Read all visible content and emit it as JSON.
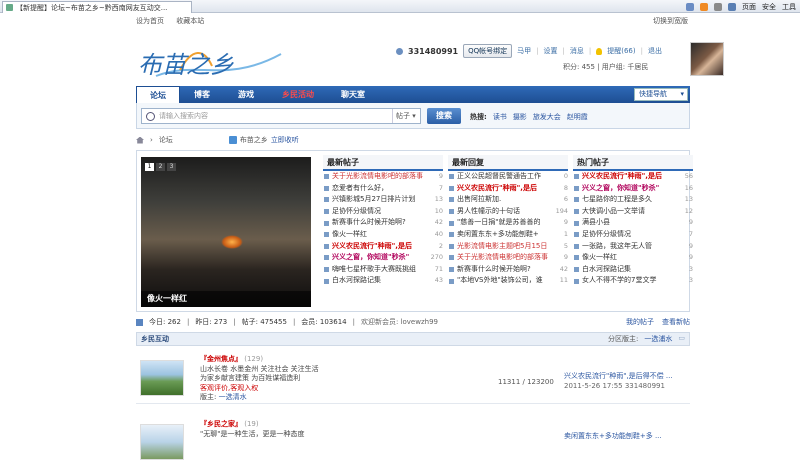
{
  "browser": {
    "tab_title": "【新提醒】论坛~布苗之乡~黔西南网友互动交...",
    "tools": [
      "页面",
      "安全",
      "工具"
    ]
  },
  "toplinks": {
    "set_home": "设为首页",
    "bookmark": "收藏本站",
    "switch_width": "切换到宽版"
  },
  "logo": {
    "text": "布苗之乡"
  },
  "user": {
    "id": "331480991",
    "qq_bind": "QQ帐号绑定",
    "links": [
      "马甲",
      "设置",
      "消息"
    ],
    "reminder": "提醒(66)",
    "logout": "退出",
    "score": "积分: 455",
    "group": "用户组: 千居民"
  },
  "nav": {
    "items": [
      "论坛",
      "博客",
      "游戏",
      "乡民活动",
      "聊天室"
    ],
    "quick": "快捷导航"
  },
  "search": {
    "placeholder": "请输入搜索内容",
    "scope": "帖子",
    "button": "搜索",
    "hot_label": "热搜:",
    "hot_words": [
      "读书",
      "摄影",
      "旅发大会",
      "赵明霞"
    ]
  },
  "breadcrumb": {
    "current": "论坛",
    "site": "布苗之乡",
    "fav": "立即收听"
  },
  "slideshow": {
    "pages": [
      "1",
      "2",
      "3"
    ],
    "caption": "像火一样红"
  },
  "columns": [
    {
      "title": "最新帖子",
      "items": [
        {
          "t": "关于光影流情电影吧的部落事",
          "n": "9",
          "s": "hl3"
        },
        {
          "t": "恋爱者有什么好，",
          "n": "7",
          "s": ""
        },
        {
          "t": "兴镇影城5月27日排片计划",
          "n": "13",
          "s": ""
        },
        {
          "t": "足协怀分级情况",
          "n": "10",
          "s": ""
        },
        {
          "t": "新赛事什么时候开始啊?",
          "n": "42",
          "s": ""
        },
        {
          "t": "像火一样红",
          "n": "40",
          "s": ""
        },
        {
          "t": "兴义农民流行\"种雨\",是后",
          "n": "2",
          "s": "hl"
        },
        {
          "t": "兴义之窗，你知道\"秒杀\"",
          "n": "270",
          "s": "hl2"
        },
        {
          "t": "嗨唯七星杯歌手大赛既挑组",
          "n": "71",
          "s": ""
        },
        {
          "t": "白水河探路记集",
          "n": "43",
          "s": ""
        }
      ]
    },
    {
      "title": "最新回复",
      "items": [
        {
          "t": "正义公民超督民警通告工作",
          "n": "0",
          "s": ""
        },
        {
          "t": "兴义农民流行\"种雨\",是后",
          "n": "8",
          "s": "hl"
        },
        {
          "t": "出售阿拉斯加.",
          "n": "6",
          "s": ""
        },
        {
          "t": "男人性幢示的十句话",
          "n": "194",
          "s": ""
        },
        {
          "t": "\"慈善一日捐\"就是苏善善的",
          "n": "9",
          "s": ""
        },
        {
          "t": "卖闲置东东+多功能刨鞋+",
          "n": "1",
          "s": ""
        },
        {
          "t": "光影流情电影主题吧5月15日",
          "n": "5",
          "s": "hl3"
        },
        {
          "t": "关于光影流情电影吧的部落事",
          "n": "9",
          "s": "hl3"
        },
        {
          "t": "新赛事什么时候开始啊?",
          "n": "42",
          "s": ""
        },
        {
          "t": "\"本地VS外地\"装饰公司，谁",
          "n": "11",
          "s": ""
        }
      ]
    },
    {
      "title": "热门帖子",
      "items": [
        {
          "t": "兴义农民流行\"种雨\",是后",
          "n": "56",
          "s": "hl"
        },
        {
          "t": "兴义之窗，你知道\"秒杀\"",
          "n": "16",
          "s": "hl2"
        },
        {
          "t": "七星路你的工程是多久",
          "n": "13",
          "s": ""
        },
        {
          "t": "大侠调小品一文举请",
          "n": "12",
          "s": ""
        },
        {
          "t": "满县小县",
          "n": "9",
          "s": ""
        },
        {
          "t": "足协怀分级情况",
          "n": "7",
          "s": ""
        },
        {
          "t": "一张路，我这年无人管",
          "n": "9",
          "s": ""
        },
        {
          "t": "像火一样红",
          "n": "9",
          "s": ""
        },
        {
          "t": "白水河探路记集",
          "n": "3",
          "s": ""
        },
        {
          "t": "女人不得不学的7堂文学",
          "n": "3",
          "s": ""
        }
      ]
    }
  ],
  "stats": {
    "today": "今日: 262",
    "yesterday": "昨日: 273",
    "posts": "帖子: 475455",
    "members": "会员: 103614",
    "welcome": "欢迎新会员: lovewzh99",
    "my_posts": "我的帖子",
    "view_new": "查看新帖"
  },
  "section": {
    "title": "乡民互动",
    "moderator_label": "分区版主:",
    "moderator": "一选浦水"
  },
  "forums": [
    {
      "name": "『金州焦点』",
      "count": "(129)",
      "desc": [
        "山水长卷  水墨金州  关注社会  关注生活",
        "为家乡献言建策  为百姓谋福造利"
      ],
      "red": "客观评价,客观入权",
      "mod_label": "版主:",
      "mod": "一选清水",
      "stat": "11311 / 123200",
      "last_title": "兴义农民流行\"种雨\",是后得不偿 ...",
      "last_time": "2011-5-26 17:55 331480991"
    },
    {
      "name": "『乡民之家』",
      "count": "(19)",
      "desc": [
        "\"无聊\"是一种生活，更是一种态度"
      ],
      "red": "",
      "mod_label": "",
      "mod": "",
      "stat": "",
      "last_title": "卖闲置东东+多功能刨鞋+多 ...",
      "last_time": ""
    }
  ]
}
